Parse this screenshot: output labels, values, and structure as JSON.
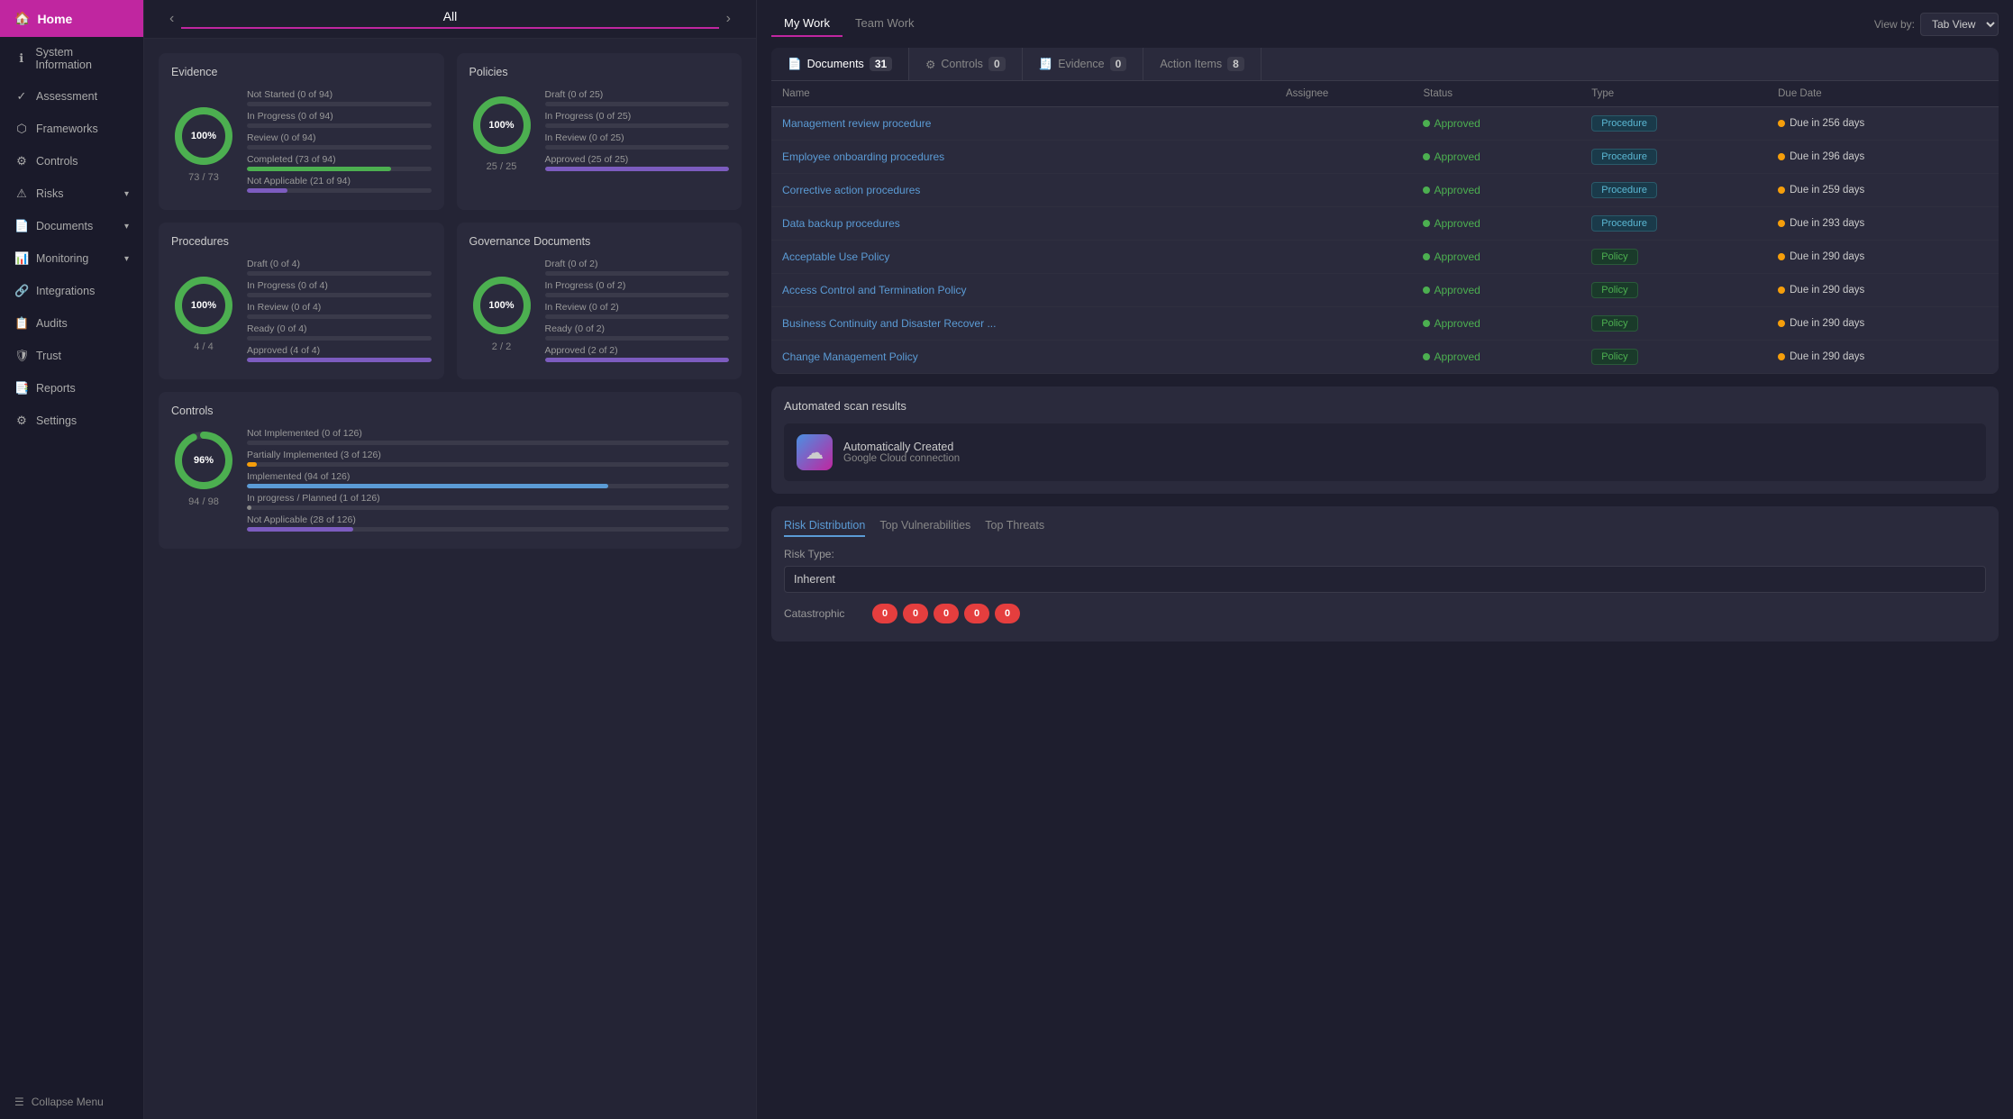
{
  "sidebar": {
    "home": "Home",
    "items": [
      {
        "label": "System Information",
        "icon": "ℹ",
        "has_arrow": false
      },
      {
        "label": "Assessment",
        "icon": "✓",
        "has_arrow": false
      },
      {
        "label": "Frameworks",
        "icon": "⬡",
        "has_arrow": false
      },
      {
        "label": "Controls",
        "icon": "⚙",
        "has_arrow": false
      },
      {
        "label": "Risks",
        "icon": "⚠",
        "has_arrow": true
      },
      {
        "label": "Documents",
        "icon": "📄",
        "has_arrow": true
      },
      {
        "label": "Monitoring",
        "icon": "📊",
        "has_arrow": true
      },
      {
        "label": "Integrations",
        "icon": "🔗",
        "has_arrow": false
      },
      {
        "label": "Audits",
        "icon": "📋",
        "has_arrow": false
      },
      {
        "label": "Trust",
        "icon": "🛡",
        "has_arrow": false
      },
      {
        "label": "Reports",
        "icon": "📑",
        "has_arrow": false
      },
      {
        "label": "Settings",
        "icon": "⚙",
        "has_arrow": false
      }
    ],
    "collapse": "Collapse Menu"
  },
  "nav": {
    "title": "All"
  },
  "evidence_card": {
    "title": "Evidence",
    "percent": "100%",
    "fraction": "73 / 73",
    "rows": [
      {
        "label": "Not Started (0 of 94)",
        "pct": 0,
        "color": "#555"
      },
      {
        "label": "In Progress (0 of 94)",
        "pct": 0,
        "color": "#555"
      },
      {
        "label": "Review (0 of 94)",
        "pct": 0,
        "color": "#555"
      },
      {
        "label": "Completed (73 of 94)",
        "pct": 78,
        "color": "#4caf50"
      },
      {
        "label": "Not Applicable (21 of 94)",
        "pct": 22,
        "color": "#7c5cbf"
      }
    ]
  },
  "policies_card": {
    "title": "Policies",
    "percent": "100%",
    "fraction": "25 / 25",
    "rows": [
      {
        "label": "Draft (0 of 25)",
        "pct": 0,
        "color": "#555"
      },
      {
        "label": "In Progress (0 of 25)",
        "pct": 0,
        "color": "#555"
      },
      {
        "label": "In Review (0 of 25)",
        "pct": 0,
        "color": "#555"
      },
      {
        "label": "Approved (25 of 25)",
        "pct": 100,
        "color": "#7c5cbf"
      }
    ]
  },
  "procedures_card": {
    "title": "Procedures",
    "percent": "100%",
    "fraction": "4 / 4",
    "rows": [
      {
        "label": "Draft (0 of 4)",
        "pct": 0,
        "color": "#555"
      },
      {
        "label": "In Progress (0 of 4)",
        "pct": 0,
        "color": "#555"
      },
      {
        "label": "In Review (0 of 4)",
        "pct": 0,
        "color": "#555"
      },
      {
        "label": "Ready (0 of 4)",
        "pct": 0,
        "color": "#555"
      },
      {
        "label": "Approved (4 of 4)",
        "pct": 100,
        "color": "#7c5cbf"
      }
    ]
  },
  "governance_card": {
    "title": "Governance Documents",
    "percent": "100%",
    "fraction": "2 / 2",
    "rows": [
      {
        "label": "Draft (0 of 2)",
        "pct": 0,
        "color": "#555"
      },
      {
        "label": "In Progress (0 of 2)",
        "pct": 0,
        "color": "#555"
      },
      {
        "label": "In Review (0 of 2)",
        "pct": 0,
        "color": "#555"
      },
      {
        "label": "Ready (0 of 2)",
        "pct": 0,
        "color": "#555"
      },
      {
        "label": "Approved (2 of 2)",
        "pct": 100,
        "color": "#7c5cbf"
      }
    ]
  },
  "controls_card": {
    "title": "Controls",
    "percent": "96%",
    "fraction": "94 / 98",
    "rows": [
      {
        "label": "Not Implemented (0 of 126)",
        "pct": 0,
        "color": "#555"
      },
      {
        "label": "Partially Implemented (3 of 126)",
        "pct": 2,
        "color": "#f59e0b"
      },
      {
        "label": "Implemented (94 of 126)",
        "pct": 75,
        "color": "#5b9bd5"
      },
      {
        "label": "In progress / Planned (1 of 126)",
        "pct": 1,
        "color": "#888"
      },
      {
        "label": "Not Applicable (28 of 126)",
        "pct": 22,
        "color": "#7c5cbf"
      }
    ]
  },
  "right_panel": {
    "tabs": [
      {
        "label": "My Work",
        "active": true
      },
      {
        "label": "Team Work",
        "active": false
      }
    ],
    "view_by_label": "View by:",
    "view_by_value": "Tab View",
    "doc_tabs": [
      {
        "icon": "📄",
        "label": "Documents",
        "count": 31,
        "active": true
      },
      {
        "icon": "⚙",
        "label": "Controls",
        "count": 0,
        "active": false
      },
      {
        "icon": "🧾",
        "label": "Evidence",
        "count": 0,
        "active": false
      },
      {
        "icon": "✓",
        "label": "Action Items",
        "count": 8,
        "active": false
      }
    ],
    "table_headers": [
      "Name",
      "Assignee",
      "Status",
      "Type",
      "Due Date"
    ],
    "table_rows": [
      {
        "name": "Management review procedure",
        "assignee": "",
        "status": "Approved",
        "type": "Procedure",
        "due": "Due in 256 days"
      },
      {
        "name": "Employee onboarding procedures",
        "assignee": "",
        "status": "Approved",
        "type": "Procedure",
        "due": "Due in 296 days"
      },
      {
        "name": "Corrective action procedures",
        "assignee": "",
        "status": "Approved",
        "type": "Procedure",
        "due": "Due in 259 days"
      },
      {
        "name": "Data backup procedures",
        "assignee": "",
        "status": "Approved",
        "type": "Procedure",
        "due": "Due in 293 days"
      },
      {
        "name": "Acceptable Use Policy",
        "assignee": "",
        "status": "Approved",
        "type": "Policy",
        "due": "Due in 290 days"
      },
      {
        "name": "Access Control and Termination Policy",
        "assignee": "",
        "status": "Approved",
        "type": "Policy",
        "due": "Due in 290 days"
      },
      {
        "name": "Business Continuity and Disaster Recover ...",
        "assignee": "",
        "status": "Approved",
        "type": "Policy",
        "due": "Due in 290 days"
      },
      {
        "name": "Change Management Policy",
        "assignee": "",
        "status": "Approved",
        "type": "Policy",
        "due": "Due in 290 days"
      }
    ],
    "scan_title": "Automated scan results",
    "scan_item": {
      "title": "Automatically Created",
      "subtitle": "Google Cloud connection"
    },
    "risk_tabs": [
      "Risk Distribution",
      "Top Vulnerabilities",
      "Top Threats"
    ],
    "risk_type_label": "Risk Type:",
    "risk_type_value": "Inherent",
    "risk_row_label": "Catastrophic",
    "risk_pills": [
      "0",
      "0",
      "0",
      "0",
      "0"
    ]
  }
}
